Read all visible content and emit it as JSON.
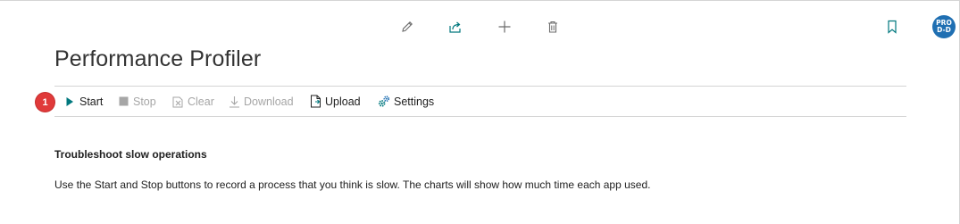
{
  "header": {
    "actions": [
      {
        "icon": "edit-pencil-icon"
      },
      {
        "icon": "share-icon"
      },
      {
        "icon": "add-plus-icon"
      },
      {
        "icon": "delete-trash-icon"
      }
    ],
    "bookmark_icon": "bookmark-icon",
    "avatar": {
      "line1": "PRO",
      "line2": "D-D",
      "color": "#1f6fb2"
    }
  },
  "page": {
    "title": "Performance Profiler"
  },
  "callout": {
    "number": "1",
    "color": "#e03a3a"
  },
  "commands": [
    {
      "label": "Start",
      "icon": "play-icon",
      "enabled": true
    },
    {
      "label": "Stop",
      "icon": "stop-square-icon",
      "enabled": false
    },
    {
      "label": "Clear",
      "icon": "clear-icon",
      "enabled": false
    },
    {
      "label": "Download",
      "icon": "download-icon",
      "enabled": false
    },
    {
      "label": "Upload",
      "icon": "upload-file-icon",
      "enabled": true
    },
    {
      "label": "Settings",
      "icon": "settings-gears-icon",
      "enabled": true
    }
  ],
  "content": {
    "heading": "Troubleshoot slow operations",
    "body": "Use the Start and Stop buttons to record a process that you think is slow. The charts will show how much time each app used."
  },
  "colors": {
    "accent_teal": "#00787e",
    "icon_gray": "#6b6b6b",
    "disabled": "#a6a6a6"
  }
}
